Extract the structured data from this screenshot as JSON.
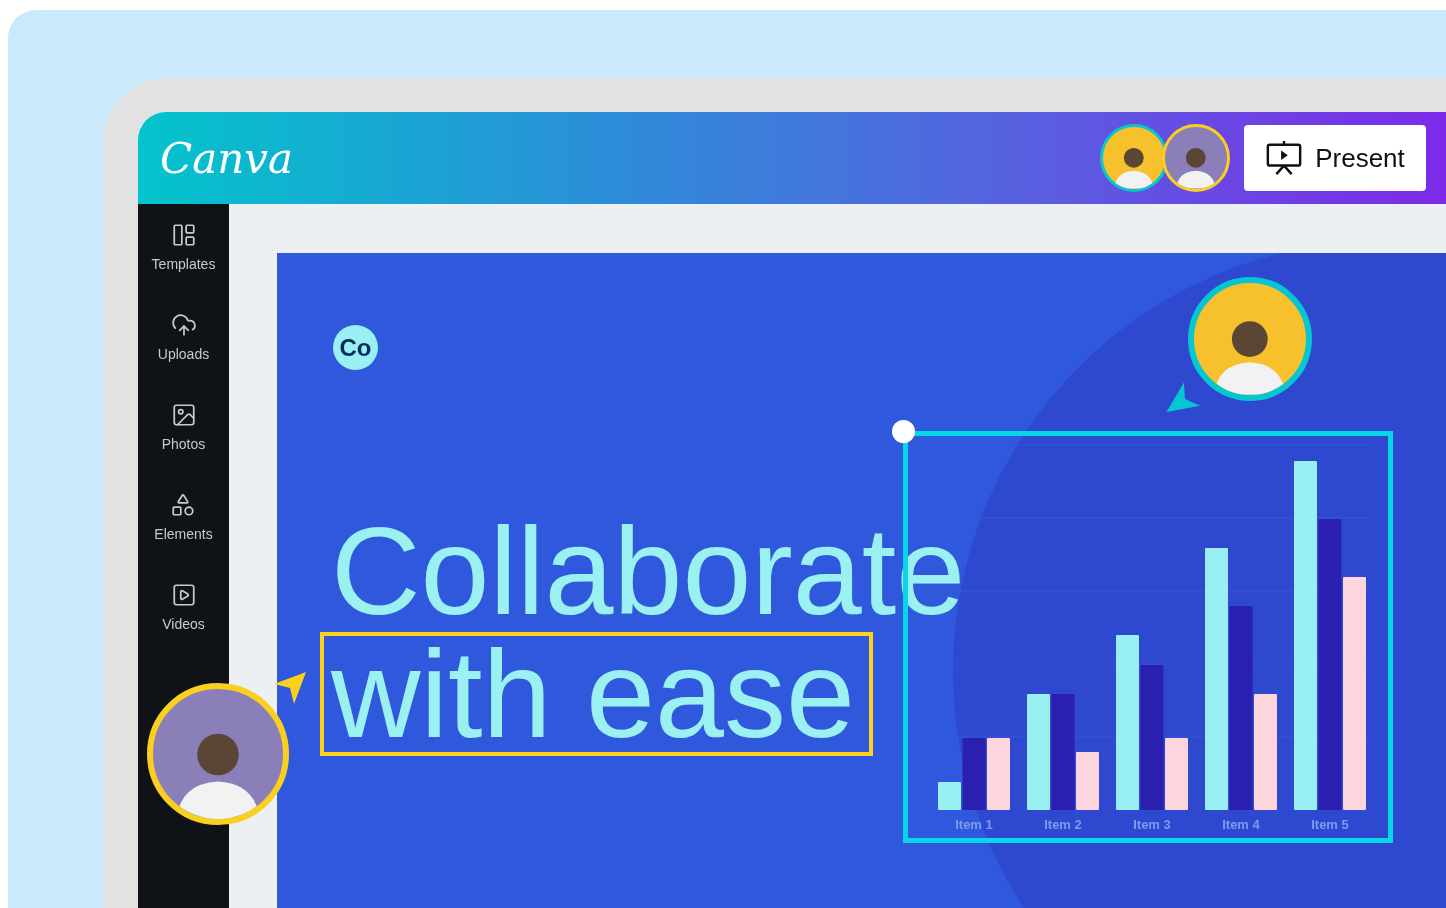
{
  "header": {
    "logo": "Canva",
    "collaborators": [
      {
        "color": "#06c6d1"
      },
      {
        "color": "#fbcf1e"
      }
    ],
    "present_button": "Present"
  },
  "sidebar": {
    "items": [
      {
        "label": "Templates"
      },
      {
        "label": "Uploads"
      },
      {
        "label": "Photos"
      },
      {
        "label": "Elements"
      },
      {
        "label": "Videos"
      }
    ]
  },
  "design": {
    "badge": "Co",
    "heading": [
      "Collaborate",
      "with ease"
    ],
    "chart": {
      "axis_labels": [
        "Item 1",
        "Item 2",
        "Item 3",
        "Item 4",
        "Item 5"
      ]
    }
  },
  "canvas_cursors": [
    {
      "color": "#06c6d1"
    },
    {
      "color": "#fbcf1e"
    }
  ]
}
